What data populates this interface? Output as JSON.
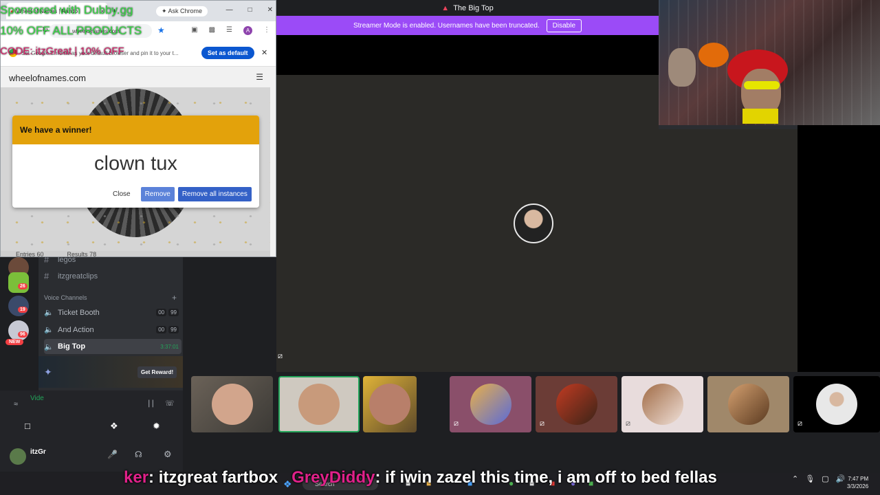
{
  "discord": {
    "window_title": "The Big Top",
    "streamer_notice": "Streamer Mode is enabled. Usernames have been truncated.",
    "disable_label": "Disable",
    "channels": {
      "text": [
        {
          "name": "legos"
        },
        {
          "name": "itzgreatclips"
        }
      ],
      "voice_header": "Voice Channels",
      "voice": [
        {
          "name": "Ticket Booth",
          "count_a": "00",
          "count_b": "99"
        },
        {
          "name": "And Action",
          "count_a": "00",
          "count_b": "99"
        },
        {
          "name": "Big Top",
          "timer": "3:37:01"
        }
      ]
    },
    "guild_badges": [
      "26",
      "19",
      "96"
    ],
    "new_badge": "NEW",
    "reward_button": "Get Reward!",
    "voice_status_prefix": "Vide",
    "username_prefix": "itzGr"
  },
  "chrome": {
    "tab_title": "Wheel of Names | Rando",
    "ask_chrome": "Ask Chrome",
    "url": "wheelofnames.com",
    "default_bar_text": "Set Google Chrome as your default browser and pin it to your t...",
    "set_default_label": "Set as default"
  },
  "wheel_site": {
    "brand": "wheelofnames.com",
    "tabs": [
      {
        "label": "Entries",
        "count": "60"
      },
      {
        "label": "Results",
        "count": "78"
      }
    ],
    "winner_heading": "We have a winner!",
    "winner_name": "clown tux",
    "close_label": "Close",
    "remove_label": "Remove",
    "remove_all_label": "Remove all instances"
  },
  "sponsor": {
    "line1": "Sponsored with Dubby.gg",
    "line2": "10% OFF ALL PRODUCTS",
    "line3": "CODE: itzGreat | 10% OFF"
  },
  "chat": {
    "user1": "ker",
    "msg1": ": itzgreat fartbox",
    "user2": "GreyDiddy",
    "msg2": ": if iwin zazel this time, i am off to bed fellas"
  },
  "clock": {
    "time": "7:47 PM",
    "date": "3/3/2026"
  },
  "taskbar": {
    "search": "Search"
  },
  "colors": {
    "streamer_bar": "#9b4bf7",
    "winner_header": "#e3a20b",
    "discord_blurple": "#5865f2"
  }
}
